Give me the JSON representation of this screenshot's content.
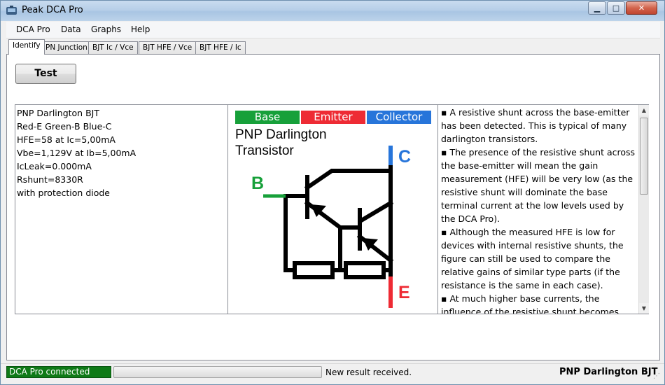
{
  "window": {
    "title": "Peak DCA Pro"
  },
  "menu": [
    "DCA Pro",
    "Data",
    "Graphs",
    "Help"
  ],
  "tabs": [
    "Identify",
    "PN Junction",
    "BJT Ic / Vce",
    "BJT HFE / Vce",
    "BJT HFE / Ic"
  ],
  "test_button": "Test",
  "info_lines": [
    "PNP Darlington BJT",
    "Red-E Green-B Blue-C",
    "HFE=58 at Ic=5,00mA",
    "Vbe=1,129V at Ib=5,00mA",
    "IcLeak=0.000mA",
    "Rshunt=8330R",
    "with protection diode"
  ],
  "diagram": {
    "legend": {
      "base": "Base",
      "emitter": "Emitter",
      "collector": "Collector"
    },
    "title_line1": "PNP Darlington",
    "title_line2": "Transistor",
    "pin_b": "B",
    "pin_c": "C",
    "pin_e": "E",
    "colors": {
      "base": "#17a03a",
      "emitter": "#ee2b34",
      "collector": "#2775da"
    }
  },
  "notes": [
    "▪ A resistive shunt across the base-emitter has been detected. This is typical of many darlington transistors.",
    "▪ The presence of the resistive shunt across the base-emitter will mean the gain measurement (HFE) will be very low (as the resistive shunt will dominate the base terminal current at the low levels used by the DCA Pro).",
    "▪ Although the measured HFE is low for devices with internal resistive shunts, the figure can still be used to compare the relative gains of similar type parts (if the resistance is the same in each case).",
    "▪ At much higher base currents, the influence of the resistive shunt becomes"
  ],
  "status": {
    "connection": "DCA Pro connected",
    "message": "New result received.",
    "part": "PNP Darlington BJT"
  }
}
